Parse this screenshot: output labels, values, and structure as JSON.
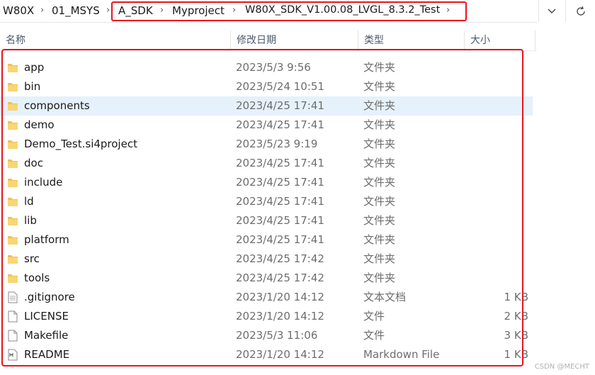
{
  "address": {
    "crumbs": [
      "W80X",
      "01_MSYS",
      "A_SDK",
      "Myproject",
      "W80X_SDK_V1.00.08_LVGL_8.3.2_Test"
    ],
    "dropdown_icon": "chevron-down-icon",
    "refresh_icon": "refresh-icon"
  },
  "columns": {
    "name": "名称",
    "date": "修改日期",
    "type": "类型",
    "size": "大小"
  },
  "files": [
    {
      "name": "app",
      "date": "2023/5/3 9:56",
      "type": "文件夹",
      "size": "",
      "icon": "folder-icon"
    },
    {
      "name": "bin",
      "date": "2023/5/24 10:51",
      "type": "文件夹",
      "size": "",
      "icon": "folder-icon"
    },
    {
      "name": "components",
      "date": "2023/4/25 17:41",
      "type": "文件夹",
      "size": "",
      "icon": "folder-icon"
    },
    {
      "name": "demo",
      "date": "2023/4/25 17:41",
      "type": "文件夹",
      "size": "",
      "icon": "folder-icon"
    },
    {
      "name": "Demo_Test.si4project",
      "date": "2023/5/23 9:19",
      "type": "文件夹",
      "size": "",
      "icon": "folder-icon"
    },
    {
      "name": "doc",
      "date": "2023/4/25 17:41",
      "type": "文件夹",
      "size": "",
      "icon": "folder-icon"
    },
    {
      "name": "include",
      "date": "2023/4/25 17:41",
      "type": "文件夹",
      "size": "",
      "icon": "folder-icon"
    },
    {
      "name": "ld",
      "date": "2023/4/25 17:41",
      "type": "文件夹",
      "size": "",
      "icon": "folder-icon"
    },
    {
      "name": "lib",
      "date": "2023/4/25 17:41",
      "type": "文件夹",
      "size": "",
      "icon": "folder-icon"
    },
    {
      "name": "platform",
      "date": "2023/4/25 17:41",
      "type": "文件夹",
      "size": "",
      "icon": "folder-icon"
    },
    {
      "name": "src",
      "date": "2023/4/25 17:42",
      "type": "文件夹",
      "size": "",
      "icon": "folder-icon"
    },
    {
      "name": "tools",
      "date": "2023/4/25 17:42",
      "type": "文件夹",
      "size": "",
      "icon": "folder-icon"
    },
    {
      "name": ".gitignore",
      "date": "2023/1/20 14:12",
      "type": "文本文档",
      "size": "1 KB",
      "icon": "text-file-icon"
    },
    {
      "name": "LICENSE",
      "date": "2023/1/20 14:12",
      "type": "文件",
      "size": "2 KB",
      "icon": "file-icon"
    },
    {
      "name": "Makefile",
      "date": "2023/5/3 11:06",
      "type": "文件",
      "size": "3 KB",
      "icon": "file-icon"
    },
    {
      "name": "README",
      "date": "2023/1/20 14:12",
      "type": "Markdown File",
      "size": "1 KB",
      "icon": "markdown-file-icon"
    }
  ],
  "watermark": "CSDN @MECHT",
  "colors": {
    "highlight_box": "#e8141c",
    "selected_row": "#e5f1fb",
    "folder": "#f0c24e"
  }
}
